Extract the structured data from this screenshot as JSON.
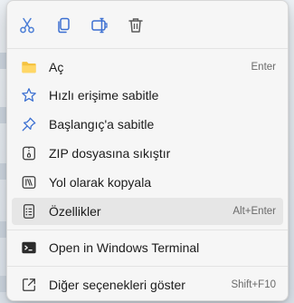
{
  "toolbar": {
    "buttons": [
      {
        "icon": "scissors-icon",
        "color": "#4a7dd6"
      },
      {
        "icon": "copy-icon",
        "color": "#3b6fd1"
      },
      {
        "icon": "rename-icon",
        "color": "#3b6fd1"
      },
      {
        "icon": "trash-icon",
        "color": "#5a5a5a"
      }
    ]
  },
  "menu": {
    "items": [
      {
        "label": "Aç",
        "shortcut": "Enter",
        "icon": "folder-icon"
      },
      {
        "label": "Hızlı erişime sabitle",
        "shortcut": "",
        "icon": "star-icon"
      },
      {
        "label": "Başlangıç'a sabitle",
        "shortcut": "",
        "icon": "pin-icon"
      },
      {
        "label": "ZIP dosyasına sıkıştır",
        "shortcut": "",
        "icon": "zip-icon"
      },
      {
        "label": "Yol olarak kopyala",
        "shortcut": "",
        "icon": "copy-path-icon"
      },
      {
        "label": "Özellikler",
        "shortcut": "Alt+Enter",
        "icon": "properties-icon",
        "highlighted": true
      },
      {
        "label": "Open in Windows Terminal",
        "shortcut": "",
        "icon": "terminal-icon"
      },
      {
        "label": "Diğer seçenekleri göster",
        "shortcut": "Shift+F10",
        "icon": "more-options-icon"
      }
    ]
  },
  "colors": {
    "accent": "#3b6fd1",
    "folder": "#f5c342",
    "menu_bg": "#f6f6f6",
    "hover": "#e6e6e6"
  }
}
